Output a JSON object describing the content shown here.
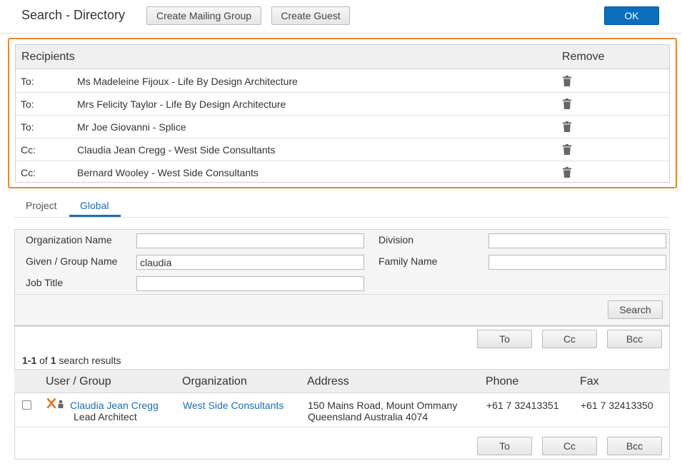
{
  "header": {
    "title": "Search - Directory",
    "create_mailing_group": "Create Mailing Group",
    "create_guest": "Create Guest",
    "ok": "OK"
  },
  "recipients": {
    "header_label": "Recipients",
    "remove_label": "Remove",
    "rows": [
      {
        "type": "To:",
        "name": "Ms Madeleine Fijoux - Life By Design Architecture"
      },
      {
        "type": "To:",
        "name": "Mrs Felicity Taylor - Life By Design Architecture"
      },
      {
        "type": "To:",
        "name": "Mr Joe Giovanni - Splice"
      },
      {
        "type": "Cc:",
        "name": "Claudia Jean Cregg - West Side Consultants"
      },
      {
        "type": "Cc:",
        "name": "Bernard Wooley - West Side Consultants"
      }
    ]
  },
  "tabs": [
    {
      "label": "Project",
      "active": false
    },
    {
      "label": "Global",
      "active": true
    }
  ],
  "form": {
    "organization_name_label": "Organization Name",
    "organization_name_value": "",
    "division_label": "Division",
    "division_value": "",
    "given_name_label": "Given / Group Name",
    "given_name_value": "claudia",
    "family_name_label": "Family Name",
    "family_name_value": "",
    "job_title_label": "Job Title",
    "job_title_value": "",
    "search_button": "Search"
  },
  "results": {
    "buttons": {
      "to": "To",
      "cc": "Cc",
      "bcc": "Bcc"
    },
    "count_range": "1-1",
    "count_of": "of",
    "count_total": "1",
    "count_suffix": "search results",
    "columns": [
      "User / Group",
      "Organization",
      "Address",
      "Phone",
      "Fax"
    ],
    "rows": [
      {
        "name": "Claudia Jean Cregg",
        "job_title": "Lead Architect",
        "organization": "West Side Consultants",
        "address_line1": "150 Mains Road, Mount Ommany",
        "address_line2": "Queensland Australia 4074",
        "phone": "+61 7 32413351",
        "fax": "+61 7 32413350",
        "icons": [
          "org-x-icon",
          "person-icon"
        ]
      }
    ]
  },
  "colors": {
    "accent": "#0a6ebd",
    "link": "#1a6fb3",
    "focus_outline": "#e88a2e",
    "org_icon": "#e07b22"
  }
}
